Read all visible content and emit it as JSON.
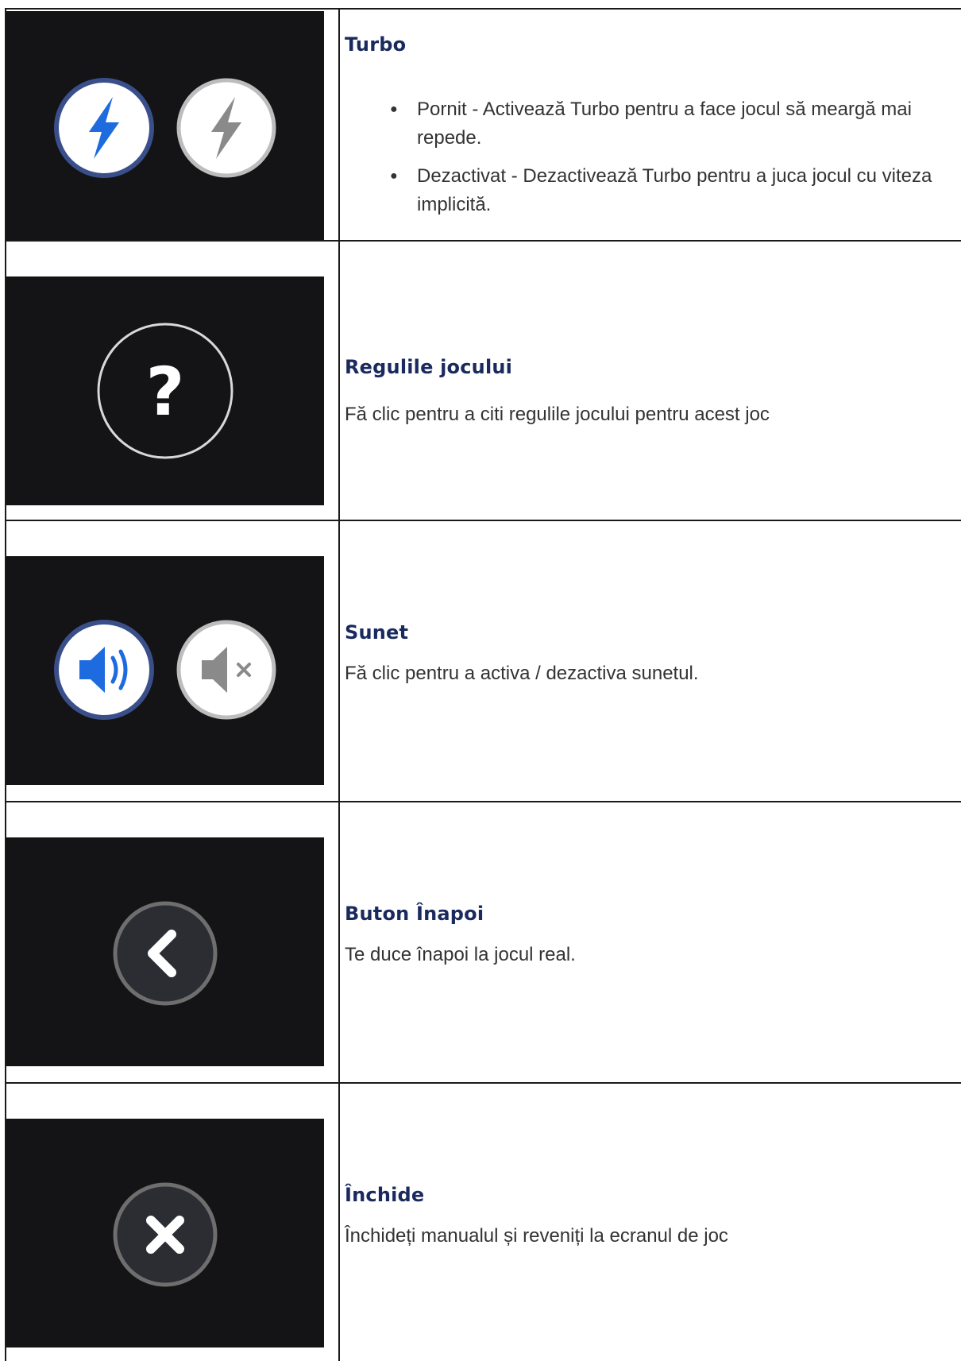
{
  "rows": [
    {
      "title": "Turbo",
      "bullets": [
        "Pornit - Activează Turbo pentru a face jocul să meargă mai repede.",
        "Dezactivat - Dezactivează Turbo pentru a juca jocul cu viteza implicită."
      ],
      "icons": [
        "turbo-on-icon",
        "turbo-off-icon"
      ]
    },
    {
      "title": "Regulile jocului",
      "text": "Fă clic pentru a citi regulile jocului pentru acest joc",
      "icons": [
        "question-mark-icon"
      ]
    },
    {
      "title": "Sunet",
      "text": "Fă clic pentru a activa / dezactiva sunetul.",
      "icons": [
        "sound-on-icon",
        "sound-off-icon"
      ]
    },
    {
      "title": "Buton Înapoi",
      "text": "Te duce înapoi la jocul real.",
      "icons": [
        "back-chevron-icon"
      ]
    },
    {
      "title": "Închide",
      "text": "Închideți manualul și reveniți la ecranul de joc",
      "icons": [
        "close-x-icon"
      ]
    }
  ],
  "colors": {
    "image_bg": "#141416",
    "active_blue": "#1e6be0",
    "title_navy": "#1a2a5e"
  }
}
